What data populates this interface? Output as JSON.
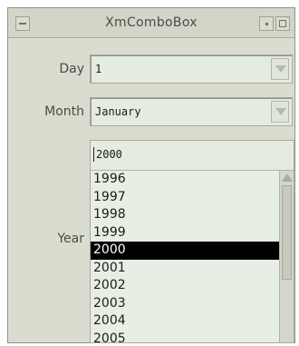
{
  "window": {
    "title": "XmComboBox"
  },
  "day": {
    "label": "Day",
    "value": "1"
  },
  "month": {
    "label": "Month",
    "value": "January"
  },
  "year": {
    "label": "Year",
    "value": "2000",
    "options": [
      "1996",
      "1997",
      "1998",
      "1999",
      "2000",
      "2001",
      "2002",
      "2003",
      "2004",
      "2005"
    ],
    "selected": "2000"
  }
}
